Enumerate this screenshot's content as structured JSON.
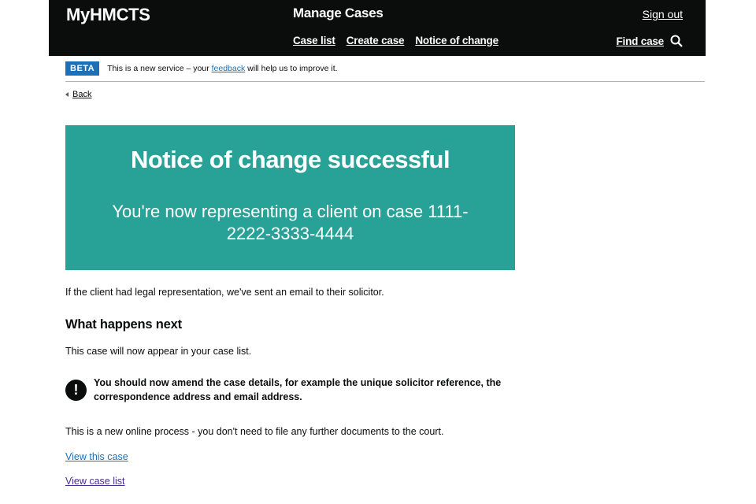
{
  "header": {
    "brand": "MyHMCTS",
    "service": "Manage Cases",
    "sign_out": "Sign out",
    "nav": [
      "Case list",
      "Create case",
      "Notice of change"
    ],
    "find_case": "Find case"
  },
  "phase_banner": {
    "tag": "BETA",
    "text_before": "This is a new service – your ",
    "link": "feedback",
    "text_after": " will help us to improve it."
  },
  "back_link": "Back",
  "panel": {
    "title": "Notice of change successful",
    "body": "You're now representing a client on case 1111-2222-3333-4444"
  },
  "main": {
    "representation_text": "If the client had legal representation, we've sent an email to their solicitor.",
    "heading": "What happens next",
    "case_list_text": "This case will now appear in your case list.",
    "warning_icon_text": "!",
    "warning_text": "You should now amend the case details, for example the unique solicitor reference, the correspondence address and email address.",
    "process_text": "This is a new online process - you don't need to file any further documents to the court.",
    "view_case_link": "View this case",
    "view_case_list_link": "View case list"
  },
  "colors": {
    "header_bg": "#0b0c0c",
    "panel_bg": "#28a197",
    "beta_tag": "#1d70b8",
    "link": "#1d70b8",
    "visited_link": "#4c2c92"
  },
  "icons": {
    "search": "search-icon",
    "back": "back-caret-icon",
    "warning": "warning-icon"
  }
}
